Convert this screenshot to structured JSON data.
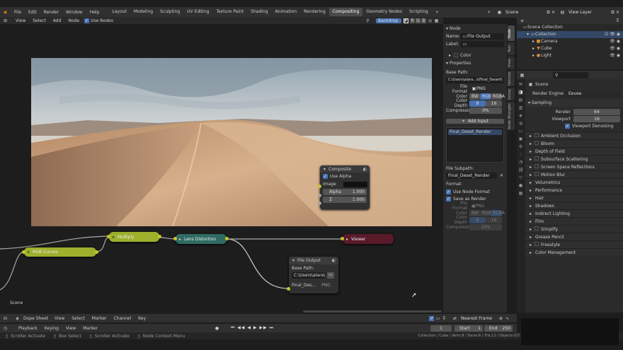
{
  "topbar": {
    "menus": [
      "File",
      "Edit",
      "Render",
      "Window",
      "Help"
    ],
    "workspaces": [
      "Layout",
      "Modeling",
      "Sculpting",
      "UV Editing",
      "Texture Paint",
      "Shading",
      "Animation",
      "Rendering",
      "Compositing",
      "Geometry Nodes",
      "Scripting"
    ],
    "active_workspace": "Compositing",
    "add_tab": "+",
    "scene": "Scene",
    "view_layer": "View Layer"
  },
  "node_header": {
    "menus": [
      "View",
      "Select",
      "Add",
      "Node"
    ],
    "use_nodes_label": "Use Nodes",
    "backdrop_label": "Backdrop",
    "channels": [
      "R",
      "G",
      "B"
    ]
  },
  "node_editor": {
    "scene_label": "Scene",
    "nodes": {
      "composite": {
        "title": "Composite",
        "use_alpha": "Use Alpha",
        "image": "Image",
        "alpha_label": "Alpha",
        "alpha_value": "1.000",
        "z_label": "Z",
        "z_value": "1.000"
      },
      "rgb_curves": "RGB Curves",
      "multiply": "Multiply",
      "lens_distortion": "Lens Distortion",
      "viewer": "Viewer",
      "file_output": {
        "title": "File Output",
        "base_path_label": "Base Path:",
        "base_path": "C:\\Users\\alara\\...",
        "slot": "Final_Des...",
        "slot_format": "PNG"
      }
    }
  },
  "sidebar": {
    "tabs": [
      "Node",
      "Tool",
      "View",
      "Options",
      "Group",
      "Node Wrangler"
    ],
    "node_section": "Node",
    "name_label": "Name:",
    "name_value": "File Output",
    "label_label": "Label:",
    "color_label": "Color",
    "properties_section": "Properties",
    "base_path_label": "Base Path:",
    "base_path_value": "C:\\Users\\alara...s\\Final_Desert\\",
    "file_format_label": "File Format",
    "file_format_value": "PNG",
    "color_label2": "Color",
    "color_modes": [
      "BW",
      "RGB",
      "RGBA"
    ],
    "color_depth_label": "Color Depth",
    "color_depth_values": [
      "8",
      "16"
    ],
    "compression_label": "Compression",
    "compression_value": "0%",
    "add_input_label": "Add Input",
    "inputs": [
      "Final_Deset_Render"
    ],
    "file_subpath_label": "File Subpath:",
    "file_subpath_value": "Final_Deset_Render",
    "format_label": "Format:",
    "use_node_format": "Use Node Format",
    "save_as_render": "Save as Render",
    "dis_file_format_label": "File Format",
    "dis_file_format_value": "PNG",
    "dis_color_label": "Color",
    "dis_color_modes": [
      "BW",
      "RGB",
      "RGBA"
    ],
    "dis_color_depth_label": "Color Depth",
    "dis_color_depth_values": [
      "8",
      "16"
    ],
    "dis_compression_label": "Compression",
    "dis_compression_value": "15%"
  },
  "outliner": {
    "root": "Scene Collection",
    "items": [
      "Collection",
      "Camera",
      "Cube",
      "Light"
    ]
  },
  "properties": {
    "scene_label": "Scene",
    "render_engine_label": "Render Engine",
    "render_engine_value": "Eevee",
    "sampling": "Sampling",
    "render_label": "Render",
    "render_value": "64",
    "viewport_label": "Viewport",
    "viewport_value": "16",
    "viewport_denoising": "Viewport Denoising",
    "panels": [
      "Ambient Occlusion",
      "Bloom",
      "Depth of Field",
      "Subsurface Scattering",
      "Screen Space Reflections",
      "Motion Blur",
      "Volumetrics",
      "Performance",
      "Hair",
      "Shadows",
      "Indirect Lighting",
      "Film",
      "Simplify",
      "Grease Pencil",
      "Freestyle",
      "Color Management"
    ]
  },
  "dopesheet": {
    "editor": "Dope Sheet",
    "menus": [
      "View",
      "Select",
      "Marker",
      "Channel",
      "Key"
    ],
    "nearest_frame": "Nearest Frame"
  },
  "timeline": {
    "menus": [
      "Playback",
      "Keying",
      "View",
      "Marker"
    ],
    "current_frame": "1",
    "start_label": "Start",
    "start_value": "1",
    "end_label": "End",
    "end_value": "250"
  },
  "statusbar": {
    "items": [
      "Scroller Activate",
      "Box Select",
      "Scroller Activate",
      "Node Context Menu"
    ],
    "right": "Collection | Cube | Verts:8 | Faces:6 | Tris:12 | Objects:0/3"
  },
  "colors": {
    "composite_header": "#3b3b3b",
    "curves": "#9cb02c",
    "multiply": "#9cb02c",
    "lens": "#2f6b62",
    "viewer": "#5a1a2a",
    "accent": "#4772b3"
  }
}
